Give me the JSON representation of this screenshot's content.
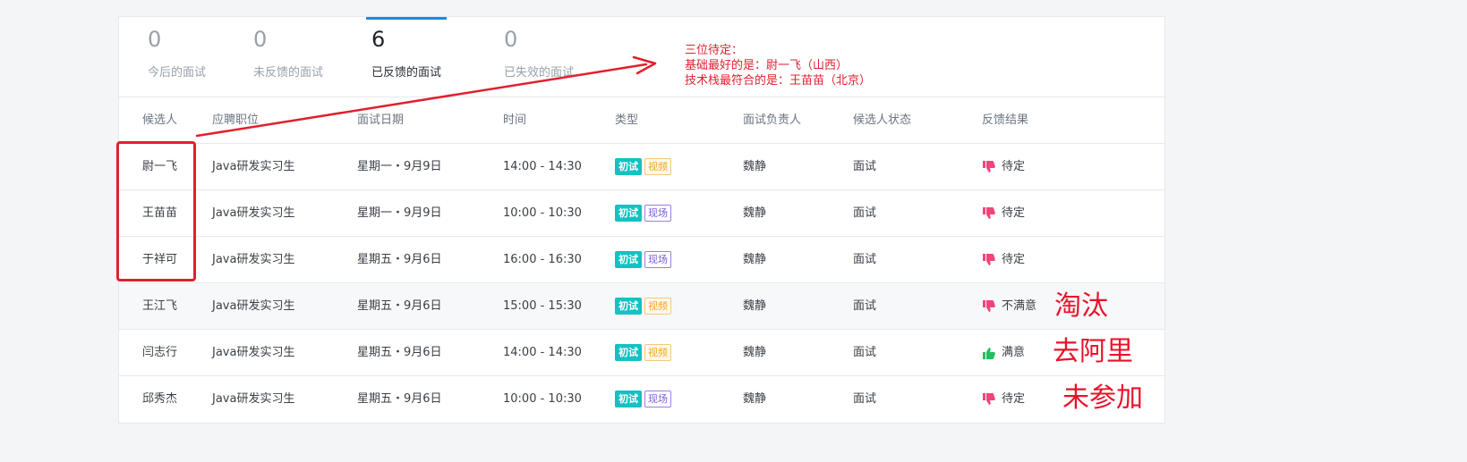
{
  "tabs": [
    {
      "count": "0",
      "label": "今后的面试",
      "active": false
    },
    {
      "count": "0",
      "label": "未反馈的面试",
      "active": false
    },
    {
      "count": "6",
      "label": "已反馈的面试",
      "active": true
    },
    {
      "count": "0",
      "label": "已失效的面试",
      "active": false
    }
  ],
  "table": {
    "headers": [
      "候选人",
      "应聘职位",
      "面试日期",
      "时间",
      "类型",
      "面试负责人",
      "候选人状态",
      "反馈结果"
    ],
    "rows": [
      {
        "candidate": "尉一飞",
        "position": "Java研发实习生",
        "date": "星期一・9月9日",
        "time": "14:00 - 14:30",
        "round": "初试",
        "mode": "视频",
        "interviewer": "魏静",
        "status": "面试",
        "feedback": "待定",
        "feedback_icon": "thumbs-down-icon"
      },
      {
        "candidate": "王苗苗",
        "position": "Java研发实习生",
        "date": "星期一・9月9日",
        "time": "10:00 - 10:30",
        "round": "初试",
        "mode": "现场",
        "interviewer": "魏静",
        "status": "面试",
        "feedback": "待定",
        "feedback_icon": "thumbs-down-icon"
      },
      {
        "candidate": "于祥可",
        "position": "Java研发实习生",
        "date": "星期五・9月6日",
        "time": "16:00 - 16:30",
        "round": "初试",
        "mode": "现场",
        "interviewer": "魏静",
        "status": "面试",
        "feedback": "待定",
        "feedback_icon": "thumbs-down-icon"
      },
      {
        "candidate": "王江飞",
        "position": "Java研发实习生",
        "date": "星期五・9月6日",
        "time": "15:00 - 15:30",
        "round": "初试",
        "mode": "视频",
        "interviewer": "魏静",
        "status": "面试",
        "feedback": "不满意",
        "feedback_icon": "thumbs-down-icon"
      },
      {
        "candidate": "闫志行",
        "position": "Java研发实习生",
        "date": "星期五・9月6日",
        "time": "14:00 - 14:30",
        "round": "初试",
        "mode": "视频",
        "interviewer": "魏静",
        "status": "面试",
        "feedback": "满意",
        "feedback_icon": "thumbs-up-icon"
      },
      {
        "candidate": "邱秀杰",
        "position": "Java研发实习生",
        "date": "星期五・9月6日",
        "time": "10:00 - 10:30",
        "round": "初试",
        "mode": "现场",
        "interviewer": "魏静",
        "status": "面试",
        "feedback": "待定",
        "feedback_icon": "thumbs-down-icon"
      }
    ]
  },
  "annotations": {
    "note_lines": [
      "三位待定：",
      "基础最好的是：尉一飞（山西）",
      "技术栈最符合的是：王苗苗（北京）"
    ],
    "side_notes": [
      "淘汰",
      "去阿里",
      "未参加"
    ]
  },
  "colors": {
    "accent": "#1e88e5",
    "annotation_red": "#e0202e",
    "tag_first": "#13c2c2",
    "tag_video": "#f5a623",
    "tag_onsite": "#7b5bd8",
    "thumbs_down": "#f0457a",
    "thumbs_up": "#1fbf5f"
  }
}
